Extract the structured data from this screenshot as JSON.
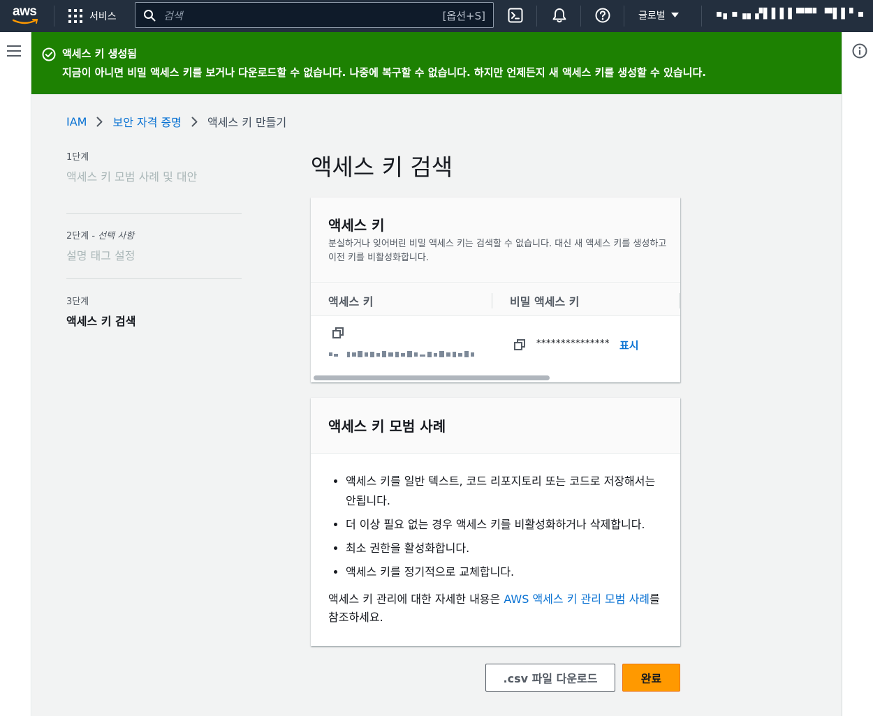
{
  "topnav": {
    "logo_text": "aws",
    "services_label": "서비스",
    "search_placeholder": "검색",
    "search_shortcut": "[옵션+S]",
    "region_label": "글로벌",
    "account_label": "▪▖▪▗▖▞▌▌▌▌▀▀▘ ▀▌▌▘▪"
  },
  "flash": {
    "title": "액세스 키 생성됨",
    "message": "지금이 아니면 비밀 액세스 키를 보거나 다운로드할 수 없습니다. 나중에 복구할 수 없습니다. 하지만 언제든지 새 액세스 키를 생성할 수 있습니다."
  },
  "breadcrumb": {
    "items": [
      {
        "label": "IAM"
      },
      {
        "label": "보안 자격 증명"
      },
      {
        "label": "액세스 키 만들기"
      }
    ]
  },
  "steps": [
    {
      "number": "1단계",
      "optional": "",
      "label": "액세스 키 모범 사례 및 대안"
    },
    {
      "number": "2단계 - ",
      "optional": "선택 사항",
      "label": "설명 태그 설정"
    },
    {
      "number": "3단계",
      "optional": "",
      "label": "액세스 키 검색"
    }
  ],
  "page_title": "액세스 키 검색",
  "access_key_card": {
    "title": "액세스 키",
    "description": "분실하거나 잊어버린 비밀 액세스 키는 검색할 수 없습니다. 대신 새 액세스 키를 생성하고 이전 키를 비활성화합니다.",
    "col_access_key": "액세스 키",
    "col_secret_key": "비밀 액세스 키",
    "secret_masked": "***************",
    "show_label": "표시"
  },
  "best_practices_card": {
    "title": "액세스 키 모범 사례",
    "items": [
      "액세스 키를 일반 텍스트, 코드 리포지토리 또는 코드로 저장해서는 안됩니다.",
      "더 이상 필요 없는 경우 액세스 키를 비활성화하거나 삭제합니다.",
      "최소 권한을 활성화합니다.",
      "액세스 키를 정기적으로 교체합니다."
    ],
    "note_prefix": "액세스 키 관리에 대한 자세한 내용은 ",
    "note_link": "AWS 액세스 키 관리 모범 사례",
    "note_suffix": "를 참조하세요."
  },
  "buttons": {
    "download_csv": ".csv 파일 다운로드",
    "done": "완료"
  },
  "colors": {
    "nav_bg": "#232f3e",
    "success": "#1d8102",
    "link": "#0972d3",
    "primary": "#ff9900"
  }
}
